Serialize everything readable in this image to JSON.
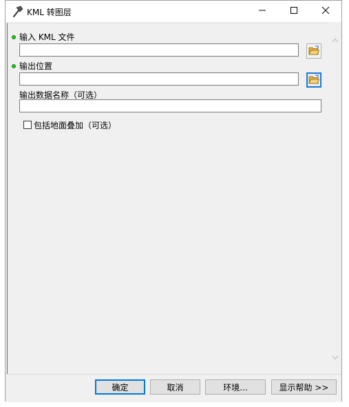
{
  "window": {
    "title": "KML 转图层",
    "controls": {
      "minimize_icon": "minimize-icon",
      "maximize_icon": "maximize-icon",
      "close_icon": "close-icon"
    }
  },
  "form": {
    "input_kml": {
      "label": "输入 KML 文件",
      "value": "",
      "required": true
    },
    "output_location": {
      "label": "输出位置",
      "value": "",
      "required": true
    },
    "output_name": {
      "label": "输出数据名称（可选）",
      "value": ""
    },
    "include_ground_overlay": {
      "label": "包括地面叠加（可选）",
      "checked": false
    }
  },
  "buttons": {
    "ok": "确定",
    "cancel": "取消",
    "environments": "环境...",
    "show_help": "显示帮助 >>"
  },
  "colors": {
    "required_dot": "#22c322",
    "focus_blue": "#0078d7",
    "folder_yellow": "#f2c14e"
  }
}
